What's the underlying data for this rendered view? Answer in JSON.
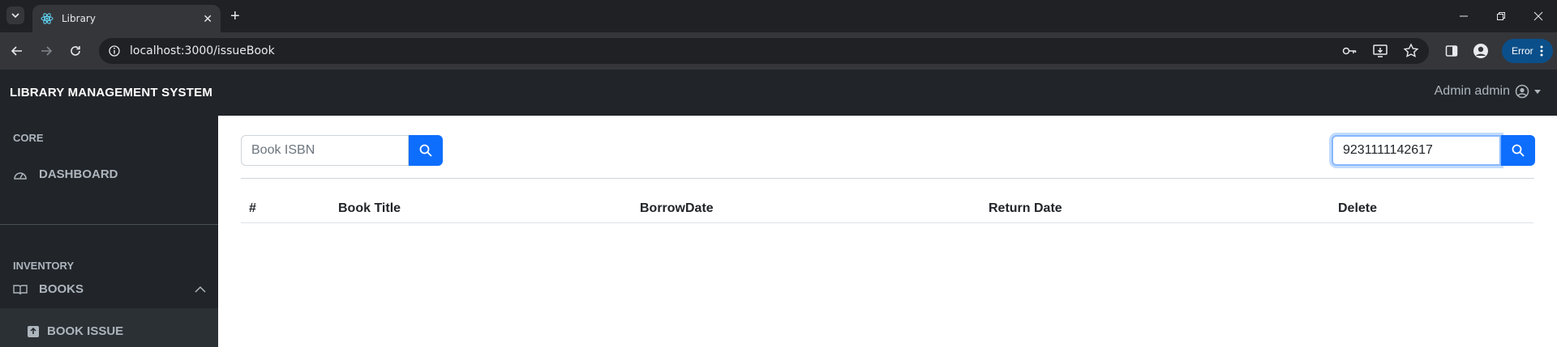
{
  "browser": {
    "tab_title": "Library",
    "url": "localhost:3000/issueBook",
    "profile_button": "Error"
  },
  "app": {
    "brand": "LIBRARY MANAGEMENT SYSTEM",
    "user_name": "Admin admin"
  },
  "sidebar": {
    "core_heading": "CORE",
    "dashboard_label": "DASHBOARD",
    "inventory_heading": "INVENTORY",
    "books_label": "BOOKS",
    "book_issue_label": "BOOK ISSUE"
  },
  "search_left": {
    "placeholder": "Book ISBN",
    "value": ""
  },
  "search_right": {
    "value": "9231111142617"
  },
  "table": {
    "headers": [
      "#",
      "Book Title",
      "BorrowDate",
      "Return Date",
      "Delete"
    ]
  }
}
